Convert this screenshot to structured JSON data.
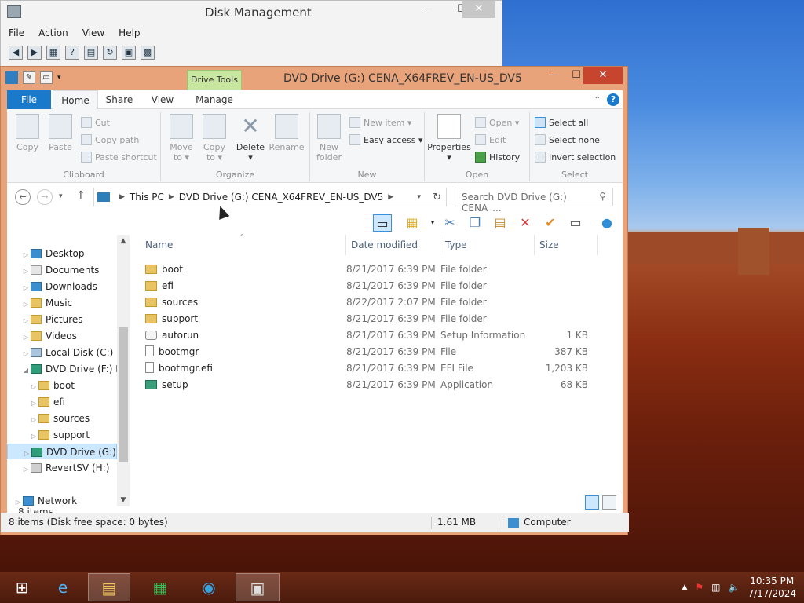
{
  "disk_management": {
    "title": "Disk Management",
    "menu": [
      "File",
      "Action",
      "View",
      "Help"
    ],
    "controls": {
      "minimize": "—",
      "maximize": "☐",
      "close": "✕"
    }
  },
  "explorer": {
    "title": "DVD Drive (G:) CENA_X64FREV_EN-US_DV5",
    "contextual_tab": "Drive Tools",
    "controls": {
      "minimize": "—",
      "maximize": "☐",
      "close": "✕"
    },
    "tabs": {
      "file": "File",
      "home": "Home",
      "share": "Share",
      "view": "View",
      "manage": "Manage"
    },
    "ribbon": {
      "clipboard": {
        "label": "Clipboard",
        "copy": "Copy",
        "paste": "Paste",
        "cut": "Cut",
        "copy_path": "Copy path",
        "paste_shortcut": "Paste shortcut"
      },
      "organize": {
        "label": "Organize",
        "move_to": "Move",
        "move_to2": "to ▾",
        "copy_to": "Copy",
        "copy_to2": "to ▾",
        "delete": "Delete",
        "delete2": "▾",
        "rename": "Rename"
      },
      "new": {
        "label": "New",
        "new_folder": "New",
        "new_folder2": "folder",
        "new_item": "New item ▾",
        "easy_access": "Easy access ▾"
      },
      "open": {
        "label": "Open",
        "properties": "Properties",
        "properties2": "▾",
        "open": "Open ▾",
        "edit": "Edit",
        "history": "History"
      },
      "select": {
        "label": "Select",
        "select_all": "Select all",
        "select_none": "Select none",
        "invert": "Invert selection"
      }
    },
    "address": {
      "crumbs": [
        "This PC",
        "DVD Drive (G:) CENA_X64FREV_EN-US_DV5"
      ],
      "search_placeholder": "Search DVD Drive (G:) CENA_..."
    },
    "nav": {
      "desktop": "Desktop",
      "documents": "Documents",
      "downloads": "Downloads",
      "music": "Music",
      "pictures": "Pictures",
      "videos": "Videos",
      "local_disk": "Local Disk (C:)",
      "dvd_f": "DVD Drive (F:) DV",
      "boot": "boot",
      "efi": "efi",
      "sources": "sources",
      "support": "support",
      "dvd_g": "DVD Drive (G:) CE",
      "revertsv": "RevertSV (H:)",
      "network": "Network"
    },
    "columns": {
      "name": "Name",
      "date": "Date modified",
      "type": "Type",
      "size": "Size"
    },
    "files": [
      {
        "name": "boot",
        "date": "8/21/2017 6:39 PM",
        "type": "File folder",
        "size": ""
      },
      {
        "name": "efi",
        "date": "8/21/2017 6:39 PM",
        "type": "File folder",
        "size": ""
      },
      {
        "name": "sources",
        "date": "8/22/2017 2:07 PM",
        "type": "File folder",
        "size": ""
      },
      {
        "name": "support",
        "date": "8/21/2017 6:39 PM",
        "type": "File folder",
        "size": ""
      },
      {
        "name": "autorun",
        "date": "8/21/2017 6:39 PM",
        "type": "Setup Information",
        "size": "1 KB"
      },
      {
        "name": "bootmgr",
        "date": "8/21/2017 6:39 PM",
        "type": "File",
        "size": "387 KB"
      },
      {
        "name": "bootmgr.efi",
        "date": "8/21/2017 6:39 PM",
        "type": "EFI File",
        "size": "1,203 KB"
      },
      {
        "name": "setup",
        "date": "8/21/2017 6:39 PM",
        "type": "Application",
        "size": "68 KB"
      }
    ],
    "item_count": "8 items",
    "status": {
      "left": "8 items (Disk free space: 0 bytes)",
      "size": "1.61 MB",
      "location": "Computer"
    }
  },
  "taskbar": {
    "time": "10:35 PM",
    "date": "7/17/2024"
  }
}
